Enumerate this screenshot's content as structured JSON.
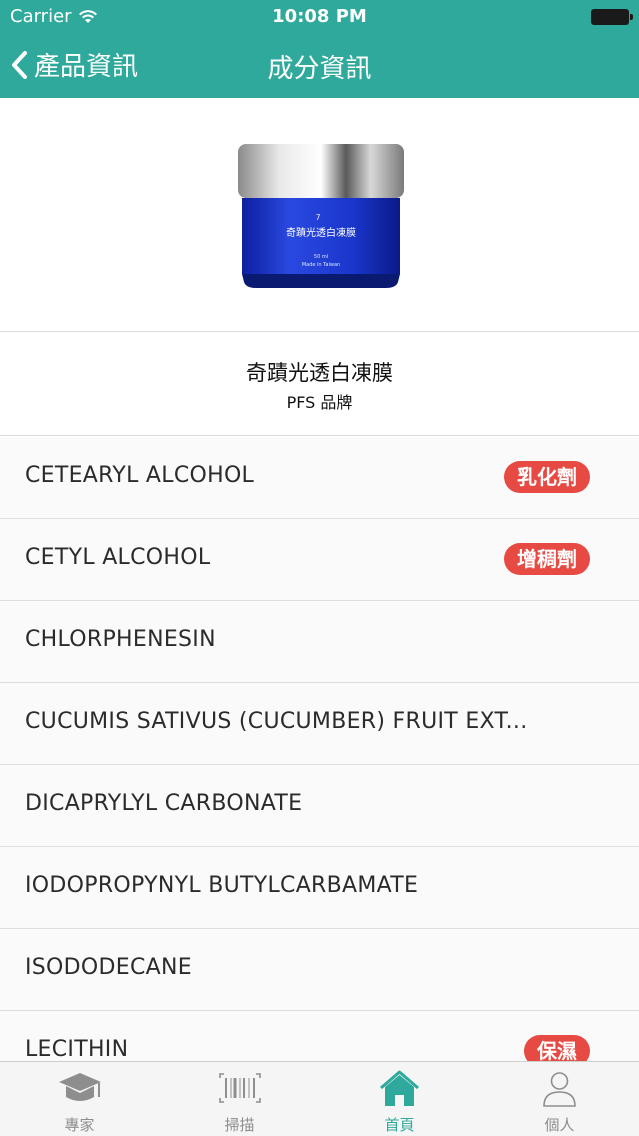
{
  "status_bar": {
    "carrier": "Carrier",
    "time": "10:08 PM"
  },
  "nav": {
    "back_label": "產品資訊",
    "title": "成分資訊"
  },
  "product": {
    "image_number": "7",
    "image_title": "奇蹟光透白凍膜",
    "image_volume": "50 ml",
    "image_origin": "Made in Taiwan",
    "name": "奇蹟光透白凍膜",
    "brand": "PFS 品牌"
  },
  "ingredients": [
    {
      "name": "CETEARYL ALCOHOL",
      "tag": "乳化劑"
    },
    {
      "name": "CETYL ALCOHOL",
      "tag": "增稠劑"
    },
    {
      "name": "CHLORPHENESIN",
      "tag": ""
    },
    {
      "name": "CUCUMIS SATIVUS (CUCUMBER) FRUIT EXT...",
      "tag": ""
    },
    {
      "name": "DICAPRYLYL CARBONATE",
      "tag": ""
    },
    {
      "name": "IODOPROPYNYL BUTYLCARBAMATE",
      "tag": ""
    },
    {
      "name": "ISODODECANE",
      "tag": ""
    },
    {
      "name": "LECITHIN",
      "tag": "保濕"
    }
  ],
  "tabs": [
    {
      "label": "專家",
      "icon": "graduation-cap-icon",
      "active": false
    },
    {
      "label": "掃描",
      "icon": "barcode-icon",
      "active": false
    },
    {
      "label": "首頁",
      "icon": "home-icon",
      "active": true
    },
    {
      "label": "個人",
      "icon": "person-icon",
      "active": false
    }
  ],
  "colors": {
    "accent": "#2fa99b",
    "badge": "#e64a42"
  }
}
